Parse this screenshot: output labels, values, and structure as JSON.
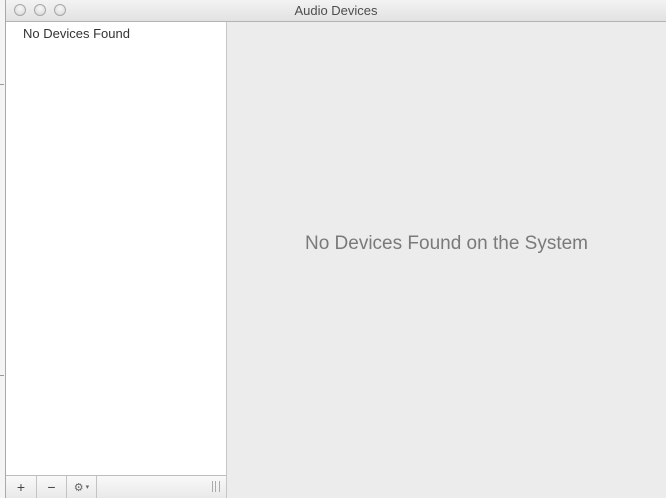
{
  "window": {
    "title": "Audio Devices"
  },
  "sidebar": {
    "items": [
      {
        "label": "No Devices Found"
      }
    ]
  },
  "toolbar": {
    "add_label": "+",
    "remove_label": "−",
    "action_icon": "gear-icon",
    "action_caret": "▾"
  },
  "main": {
    "empty_message": "No Devices Found on the System"
  }
}
